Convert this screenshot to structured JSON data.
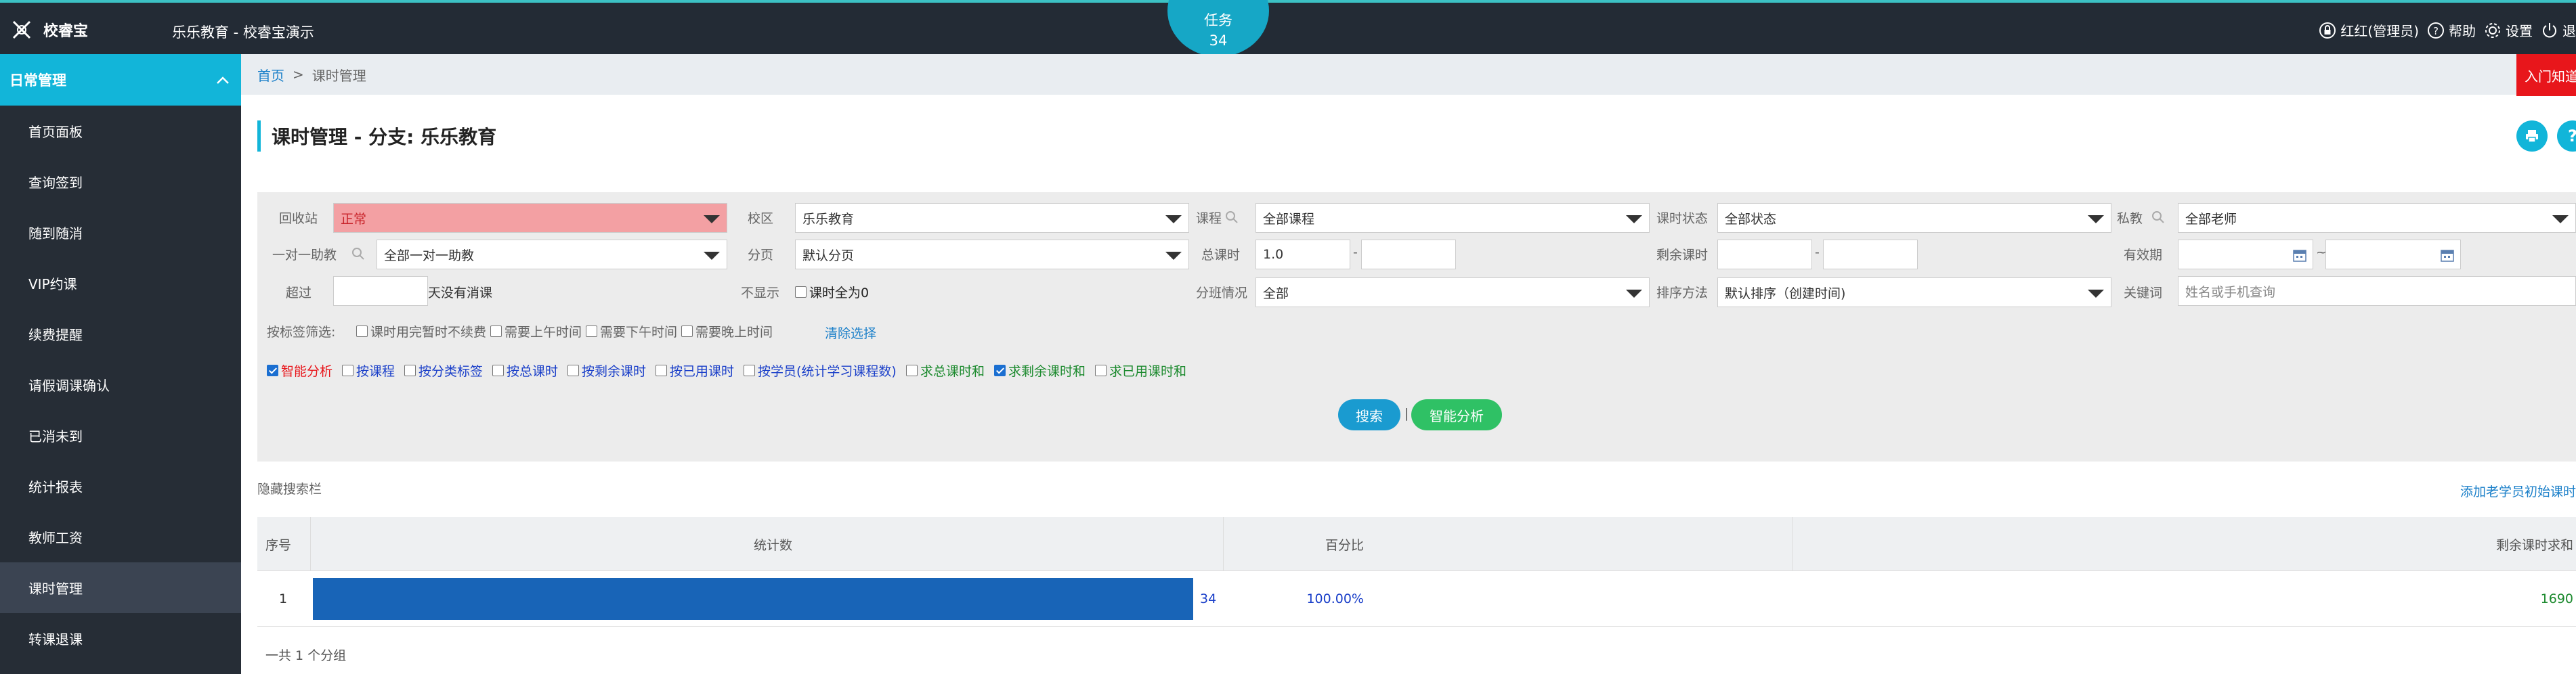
{
  "app": {
    "logo_text": "校睿宝",
    "title": "乐乐教育 - 校睿宝演示",
    "task_label": "任务",
    "task_count": "34"
  },
  "toolbar": {
    "user": "红红(管理员)",
    "help": "帮助",
    "settings": "设置",
    "logout": "退"
  },
  "sidebar": {
    "section": "日常管理",
    "items": [
      {
        "label": "首页面板"
      },
      {
        "label": "查询签到"
      },
      {
        "label": "随到随消"
      },
      {
        "label": "VIP约课"
      },
      {
        "label": "续费提醒"
      },
      {
        "label": "请假调课确认"
      },
      {
        "label": "已消未到"
      },
      {
        "label": "统计报表"
      },
      {
        "label": "教师工资"
      },
      {
        "label": "课时管理"
      },
      {
        "label": "转课退课"
      }
    ],
    "active_index": 9
  },
  "breadcrumb": {
    "home": "首页",
    "separator": ">",
    "current": "课时管理"
  },
  "notice_button": "入门知道",
  "page": {
    "title": "课时管理 - 分支: 乐乐教育"
  },
  "filters": {
    "recycle": {
      "label": "回收站",
      "value": "正常"
    },
    "campus": {
      "label": "校区",
      "value": "乐乐教育"
    },
    "course": {
      "label": "课程",
      "value": "全部课程"
    },
    "hour_status": {
      "label": "课时状态",
      "value": "全部状态"
    },
    "private_teacher": {
      "label": "私教",
      "value": "全部老师"
    },
    "assistant": {
      "label": "一对一助教",
      "value": "全部一对一助教"
    },
    "branch": {
      "label": "分页",
      "value": "默认分页"
    },
    "total_hours": {
      "label": "总课时",
      "from": "1.0",
      "to": "",
      "dash": "-"
    },
    "remaining_hours": {
      "label": "剩余课时",
      "from": "",
      "to": "",
      "dash": "-"
    },
    "validity": {
      "label": "有效期",
      "from": "",
      "to": "",
      "dash": "~"
    },
    "exceed": {
      "label": "超过",
      "value": "",
      "suffix": "天没有消课"
    },
    "hidden": {
      "label": "不显示",
      "checkbox": "课时全为0"
    },
    "class_status": {
      "label": "分班情况",
      "value": "全部"
    },
    "sort": {
      "label": "排序方法",
      "value": "默认排序（创建时间)"
    },
    "keyword": {
      "label": "关键词",
      "placeholder": "姓名或手机查询"
    },
    "tag_filter": {
      "label": "按标签筛选:",
      "options": [
        "课时用完暂时不续费",
        "需要上午时间",
        "需要下午时间",
        "需要晚上时间"
      ],
      "clear": "清除选择"
    },
    "analysis_options": [
      {
        "label": "智能分析",
        "checked": true,
        "color": "#e8161b"
      },
      {
        "label": "按课程",
        "checked": false,
        "color": "#1a3fc9"
      },
      {
        "label": "按分类标签",
        "checked": false,
        "color": "#1a3fc9"
      },
      {
        "label": "按总课时",
        "checked": false,
        "color": "#1a3fc9"
      },
      {
        "label": "按剩余课时",
        "checked": false,
        "color": "#1a3fc9"
      },
      {
        "label": "按已用课时",
        "checked": false,
        "color": "#1a3fc9"
      },
      {
        "label": "按学员(统计学习课程数)",
        "checked": false,
        "color": "#1a3fc9"
      },
      {
        "label": "求总课时和",
        "checked": false,
        "color": "#1c8a2e"
      },
      {
        "label": "求剩余课时和",
        "checked": true,
        "color": "#1c8a2e"
      },
      {
        "label": "求已用课时和",
        "checked": false,
        "color": "#1c8a2e"
      }
    ],
    "search_button": "搜索",
    "divider": "|",
    "analysis_button": "智能分析"
  },
  "results": {
    "hide_search": "隐藏搜索栏",
    "add_link": "添加老学员初始课时",
    "headers": {
      "index": "序号",
      "count": "统计数",
      "percent": "百分比",
      "remaining_sum": "剩余课时求和"
    },
    "rows": [
      {
        "index": "1",
        "count": "34",
        "share": 1.0,
        "percent": "100.00%",
        "remaining_sum": "1690"
      }
    ],
    "summary": "一共 1 个分组"
  },
  "colors": {
    "topbar": "#232b35",
    "accent": "#12b5d9",
    "bar": "#1864b7",
    "search_button": "#1a9bd0",
    "analysis_button": "#2fc165",
    "notice": "#e8161b"
  }
}
